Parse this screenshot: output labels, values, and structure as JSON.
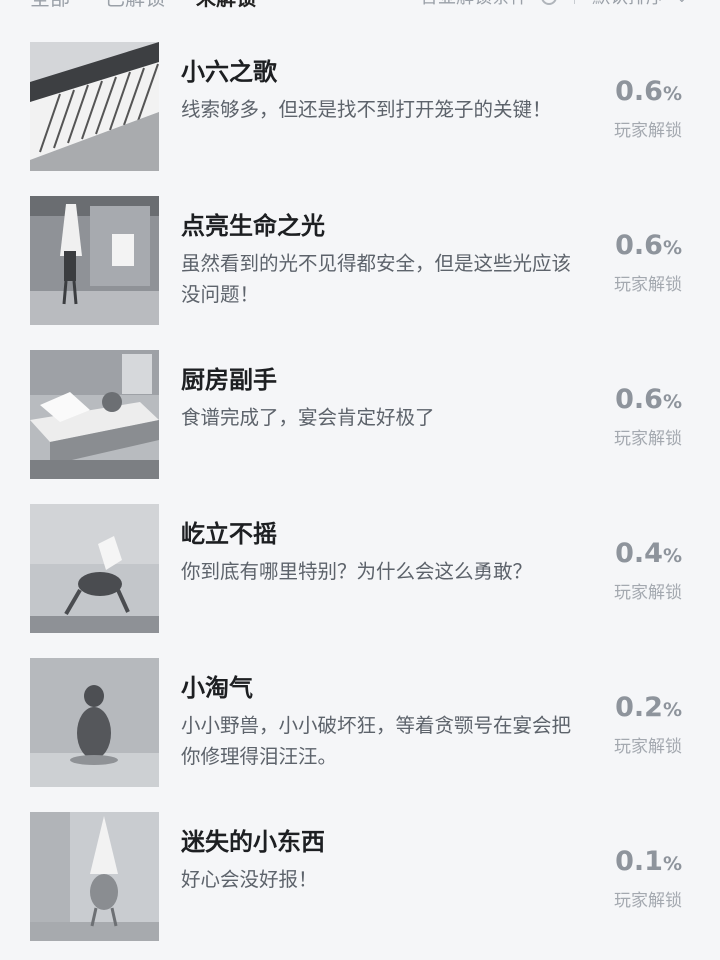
{
  "top_bar": {
    "tab_all": "全部",
    "tab_unlocked": "已解锁",
    "tab_locked": "未解锁",
    "filter_label": "合並解锁条件",
    "sort_label": "默认排序",
    "sort_icon": "chevron-down-icon",
    "filter_icon": "info-icon"
  },
  "achievements": [
    {
      "title": "小六之歌",
      "description": "线索够多，但还是找不到打开笼子的关键！",
      "percent": "0.6",
      "unit": "%",
      "percent_label": "玩家解锁",
      "thumbnail": "piano"
    },
    {
      "title": "点亮生命之光",
      "description": "虽然看到的光不见得都安全，但是这些光应该没问题！",
      "percent": "0.6",
      "unit": "%",
      "percent_label": "玩家解锁",
      "thumbnail": "girl-in-room"
    },
    {
      "title": "厨房副手",
      "description": "食谱完成了，宴会肯定好极了",
      "percent": "0.6",
      "unit": "%",
      "percent_label": "玩家解锁",
      "thumbnail": "kitchen-table"
    },
    {
      "title": "屹立不摇",
      "description": "你到底有哪里特别？为什么会这么勇敢？",
      "percent": "0.4",
      "unit": "%",
      "percent_label": "玩家解锁",
      "thumbnail": "crouching-figure"
    },
    {
      "title": "小淘气",
      "description": "小小野兽，小小破坏狂，等着贪颚号在宴会把你修理得泪汪汪。",
      "percent": "0.2",
      "unit": "%",
      "percent_label": "玩家解锁",
      "thumbnail": "small-creature"
    },
    {
      "title": "迷失的小东西",
      "description": "好心会没好报！",
      "percent": "0.1",
      "unit": "%",
      "percent_label": "玩家解锁",
      "thumbnail": "nome"
    }
  ]
}
